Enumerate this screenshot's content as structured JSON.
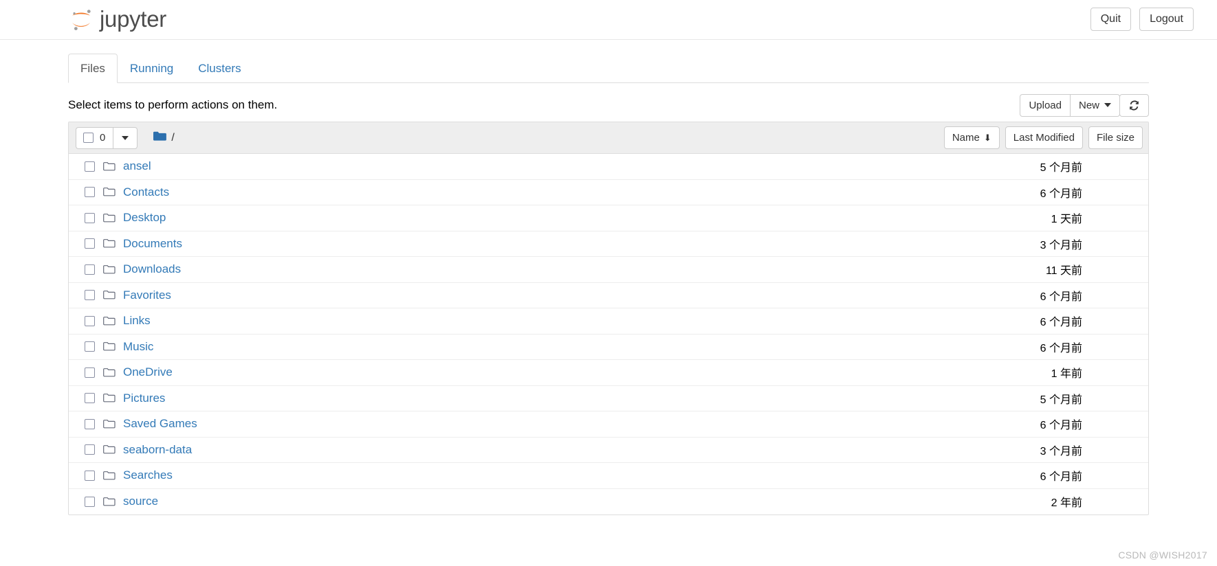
{
  "navbar": {
    "brand_text": "jupyter",
    "brand_logo_icon": "jupyter-logo-icon",
    "quit_label": "Quit",
    "logout_label": "Logout"
  },
  "tabs": [
    {
      "label": "Files",
      "active": true
    },
    {
      "label": "Running",
      "active": false
    },
    {
      "label": "Clusters",
      "active": false
    }
  ],
  "toolbar": {
    "message": "Select items to perform actions on them.",
    "upload_label": "Upload",
    "new_label": "New",
    "new_caret_icon": "chevron-down-icon",
    "refresh_icon": "refresh-icon",
    "refresh_glyph": "↻"
  },
  "list_header": {
    "select_all_count": "0",
    "select_all_caret_icon": "chevron-down-icon",
    "folder_icon": "folder-filled-icon",
    "breadcrumb_root": "/",
    "sort_name_label": "Name",
    "sort_name_arrow": "⬇",
    "sort_modified_label": "Last Modified",
    "sort_size_label": "File size"
  },
  "columns": {
    "name": "Name",
    "last_modified": "Last Modified",
    "file_size": "File size"
  },
  "items": [
    {
      "name": "ansel",
      "icon": "folder-icon",
      "modified": "5 个月前",
      "size": ""
    },
    {
      "name": "Contacts",
      "icon": "folder-icon",
      "modified": "6 个月前",
      "size": ""
    },
    {
      "name": "Desktop",
      "icon": "folder-icon",
      "modified": "1 天前",
      "size": ""
    },
    {
      "name": "Documents",
      "icon": "folder-icon",
      "modified": "3 个月前",
      "size": ""
    },
    {
      "name": "Downloads",
      "icon": "folder-icon",
      "modified": "11 天前",
      "size": ""
    },
    {
      "name": "Favorites",
      "icon": "folder-icon",
      "modified": "6 个月前",
      "size": ""
    },
    {
      "name": "Links",
      "icon": "folder-icon",
      "modified": "6 个月前",
      "size": ""
    },
    {
      "name": "Music",
      "icon": "folder-icon",
      "modified": "6 个月前",
      "size": ""
    },
    {
      "name": "OneDrive",
      "icon": "folder-icon",
      "modified": "1 年前",
      "size": ""
    },
    {
      "name": "Pictures",
      "icon": "folder-icon",
      "modified": "5 个月前",
      "size": ""
    },
    {
      "name": "Saved Games",
      "icon": "folder-icon",
      "modified": "6 个月前",
      "size": ""
    },
    {
      "name": "seaborn-data",
      "icon": "folder-icon",
      "modified": "3 个月前",
      "size": ""
    },
    {
      "name": "Searches",
      "icon": "folder-icon",
      "modified": "6 个月前",
      "size": ""
    },
    {
      "name": "source",
      "icon": "folder-icon",
      "modified": "2 年前",
      "size": ""
    }
  ],
  "watermark": "CSDN @WISH2017",
  "colors": {
    "link": "#337ab7",
    "logo_orange": "#f37726",
    "logo_gray": "#9e9e9e",
    "folder_blue": "#2c6fad",
    "header_bg": "#eeeeee",
    "border": "#dddddd"
  }
}
